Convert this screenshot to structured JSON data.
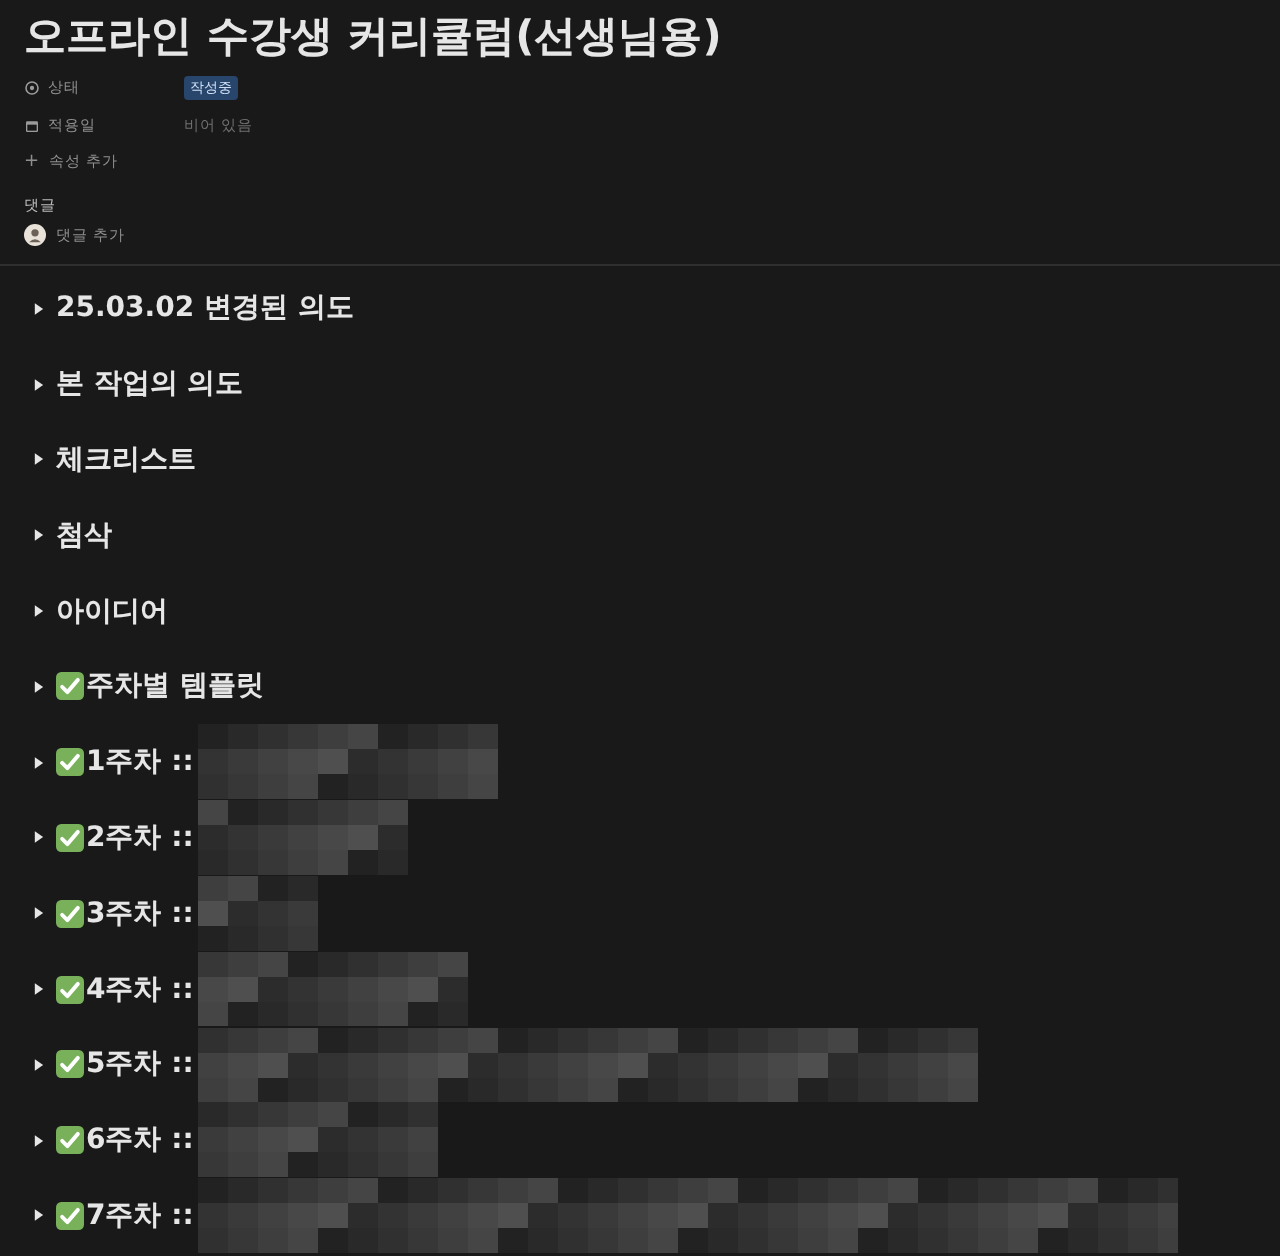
{
  "page": {
    "title": "오프라인 수강생 커리큘럼(선생님용)"
  },
  "properties": [
    {
      "kind": "status",
      "label": "상태",
      "value": "작성중"
    },
    {
      "kind": "date",
      "label": "적용일",
      "value": "비어 있음"
    }
  ],
  "add_property": {
    "icon": "+",
    "label": "속성 추가"
  },
  "comments": {
    "heading": "댓글",
    "add_label": "댓글 추가"
  },
  "toggles": [
    {
      "title": "25.03.02 변경된 의도",
      "done": false,
      "redacted": false
    },
    {
      "title": "본 작업의 의도",
      "done": false,
      "redacted": false
    },
    {
      "title": "체크리스트",
      "done": false,
      "redacted": false
    },
    {
      "title": "첨삭",
      "done": false,
      "redacted": false
    },
    {
      "title": "아이디어",
      "done": false,
      "redacted": false
    },
    {
      "title": "주차별 템플릿",
      "done": true,
      "redacted": false
    },
    {
      "title": "1주차 ::",
      "done": true,
      "redacted": true
    },
    {
      "title": "2주차 ::",
      "done": true,
      "redacted": true
    },
    {
      "title": "3주차 ::",
      "done": true,
      "redacted": true
    },
    {
      "title": "4주차 ::",
      "done": true,
      "redacted": true
    },
    {
      "title": "5주차 ::",
      "done": true,
      "redacted": true
    },
    {
      "title": "6주차 ::",
      "done": true,
      "redacted": true
    },
    {
      "title": "7주차 ::",
      "done": true,
      "redacted": true
    }
  ]
}
